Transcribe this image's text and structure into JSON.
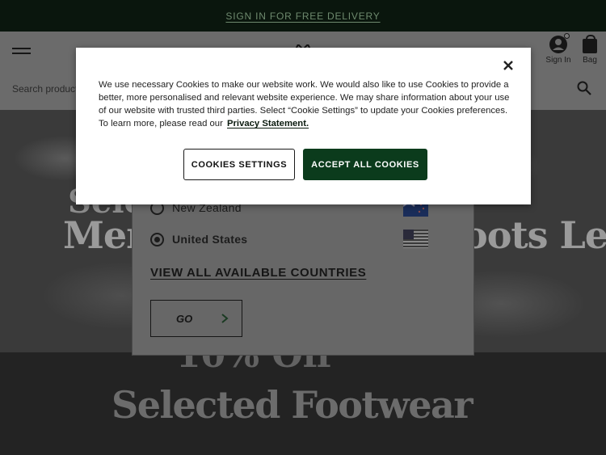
{
  "promo": {
    "text": "SIGN IN FOR FREE DELIVERY"
  },
  "header": {
    "signin_label": "Sign In",
    "bag_label": "Bag",
    "search_placeholder": "Search products"
  },
  "hero": {
    "line1": "Selected Styles",
    "line2": "Men's & Women's Boots Less"
  },
  "band": {
    "line1": "10% Off",
    "line2": "Selected Footwear"
  },
  "country_modal": {
    "options": [
      {
        "label": "New Zealand",
        "selected": false,
        "flag": "new-zealand-flag"
      },
      {
        "label": "United States",
        "selected": true,
        "flag": "united-states-flag"
      }
    ],
    "view_all_label": "VIEW ALL AVAILABLE COUNTRIES",
    "go_label": "GO"
  },
  "cookie_dialog": {
    "body": "We use necessary Cookies to make our website work. We would also like to use Cookies to provide a better, more personalised and relevant website experience. We may share information about your use of our website with trusted third parties. Select “Cookie Settings” to update your Cookies preferences. To learn more, please read our",
    "privacy_link": "Privacy Statement.",
    "settings_button": "COOKIES SETTINGS",
    "accept_button": "ACCEPT ALL COOKIES"
  },
  "colors": {
    "brand_dark_green": "#0b3b1c",
    "promo_bg": "#0a160d",
    "overlay_dim": "#6b6b6b"
  }
}
